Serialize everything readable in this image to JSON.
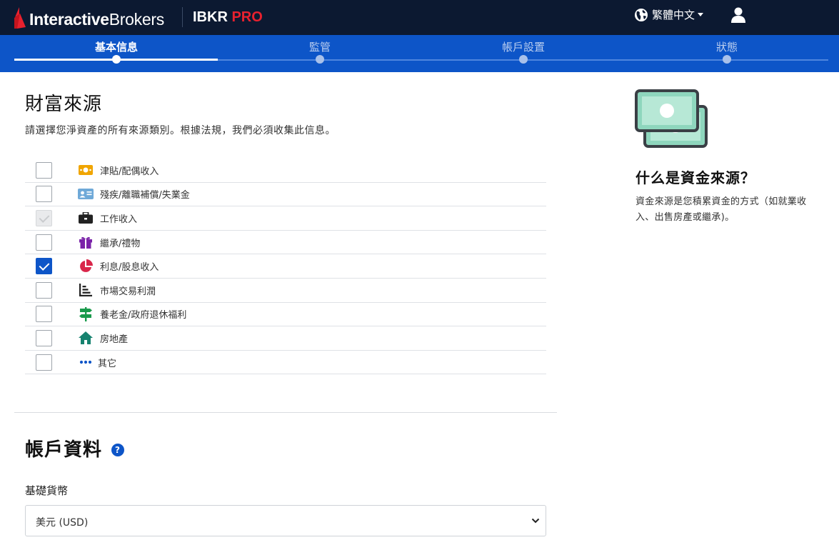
{
  "brand": {
    "logo_interactive": "Interactive",
    "logo_brokers": "Brokers",
    "product_prefix": "IBKR",
    "product_suffix": "PRO"
  },
  "header": {
    "language": "繁體中文"
  },
  "stepper": {
    "steps": [
      "基本信息",
      "監管",
      "帳戶設置",
      "狀態"
    ],
    "active_index": 0
  },
  "wealth": {
    "title": "財富來源",
    "subtitle": "請選擇您淨資產的所有來源類別。根據法規，我們必須收集此信息。",
    "items": [
      {
        "label": "津貼/配偶收入",
        "icon": "money-icon",
        "checked": false,
        "disabled": false
      },
      {
        "label": "殘疾/離職補償/失業金",
        "icon": "id-card-icon",
        "checked": false,
        "disabled": false
      },
      {
        "label": "工作收入",
        "icon": "briefcase-icon",
        "checked": true,
        "disabled": true
      },
      {
        "label": "繼承/禮物",
        "icon": "gift-icon",
        "checked": false,
        "disabled": false
      },
      {
        "label": "利息/股息收入",
        "icon": "pie-chart-icon",
        "checked": true,
        "disabled": false
      },
      {
        "label": "市場交易利潤",
        "icon": "bar-chart-icon",
        "checked": false,
        "disabled": false
      },
      {
        "label": "養老金/政府退休福利",
        "icon": "signpost-icon",
        "checked": false,
        "disabled": false
      },
      {
        "label": "房地產",
        "icon": "house-icon",
        "checked": false,
        "disabled": false
      },
      {
        "label": "其它",
        "icon": "ellipsis-icon",
        "checked": false,
        "disabled": false
      }
    ]
  },
  "account": {
    "title": "帳戶資料",
    "help": "?",
    "base_currency_label": "基礎貨幣",
    "base_currency_value": "美元 (USD)"
  },
  "sidebar": {
    "title": "什么是資金來源？",
    "text": "資金來源是您積累資金的方式（如就業收入、出售房產或繼承)。"
  },
  "colors": {
    "topbar": "#0c1931",
    "accent": "#0d55c8",
    "brand_red": "#e8212e"
  }
}
